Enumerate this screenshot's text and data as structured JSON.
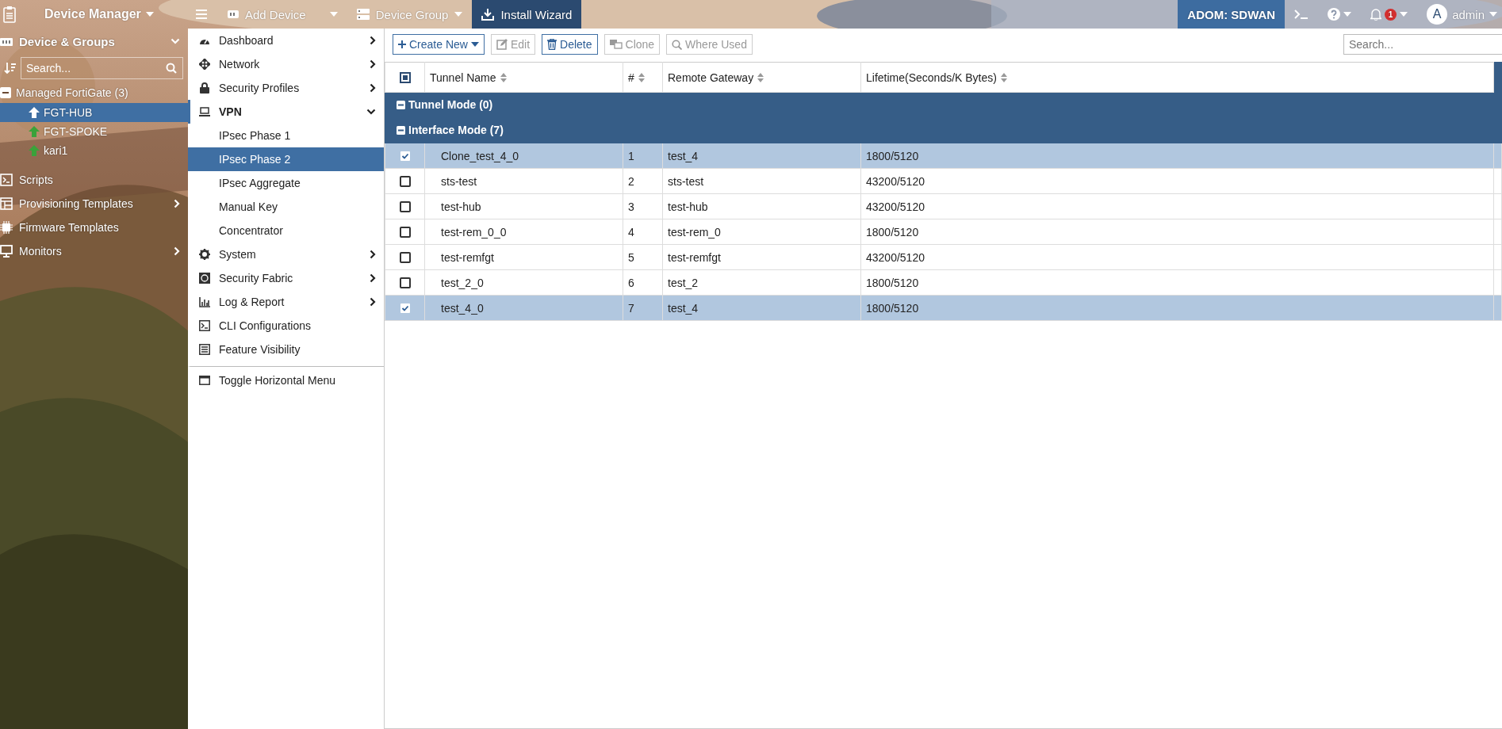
{
  "topbar": {
    "app": "Device Manager",
    "menu": [
      {
        "label": "Add Device",
        "kind": "split",
        "selected": false
      },
      {
        "label": "Device Group",
        "kind": "dropdown",
        "selected": false
      },
      {
        "label": "Install Wizard",
        "kind": "plain",
        "selected": true
      }
    ],
    "adom": "ADOM: SDWAN",
    "notifications": "1",
    "avatar": "A",
    "user": "admin"
  },
  "sidebar": {
    "title": "Device & Groups",
    "search_placeholder": "Search...",
    "tree": [
      {
        "label": "Managed FortiGate (3)",
        "expanded": true,
        "children": [
          {
            "label": "FGT-HUB",
            "selected": true
          },
          {
            "label": "FGT-SPOKE",
            "selected": false
          },
          {
            "label": "kari1",
            "selected": false
          }
        ]
      }
    ],
    "nav": [
      {
        "label": "Scripts",
        "has_submenu": false
      },
      {
        "label": "Provisioning Templates",
        "has_submenu": true
      },
      {
        "label": "Firmware Templates",
        "has_submenu": false
      },
      {
        "label": "Monitors",
        "has_submenu": true
      }
    ]
  },
  "menu": [
    {
      "label": "Dashboard",
      "has_submenu": true,
      "expanded": false
    },
    {
      "label": "Network",
      "has_submenu": true,
      "expanded": false
    },
    {
      "label": "Security Profiles",
      "has_submenu": true,
      "expanded": false
    },
    {
      "label": "VPN",
      "has_submenu": true,
      "expanded": true,
      "children": [
        {
          "label": "IPsec Phase 1",
          "selected": false
        },
        {
          "label": "IPsec Phase 2",
          "selected": true
        },
        {
          "label": "IPsec Aggregate",
          "selected": false
        },
        {
          "label": "Manual Key",
          "selected": false
        },
        {
          "label": "Concentrator",
          "selected": false
        }
      ]
    },
    {
      "label": "System",
      "has_submenu": true,
      "expanded": false
    },
    {
      "label": "Security Fabric",
      "has_submenu": true,
      "expanded": false
    },
    {
      "label": "Log & Report",
      "has_submenu": true,
      "expanded": false
    },
    {
      "label": "CLI Configurations",
      "has_submenu": false,
      "expanded": false
    },
    {
      "label": "Feature Visibility",
      "has_submenu": false,
      "expanded": false
    },
    {
      "label": "Toggle Horizontal Menu",
      "has_submenu": false,
      "expanded": false,
      "kind": "footer"
    }
  ],
  "toolbar": {
    "buttons": [
      {
        "label": "Create New",
        "disabled": false,
        "kind": "create"
      },
      {
        "label": "Edit",
        "disabled": true,
        "kind": "edit"
      },
      {
        "label": "Delete",
        "disabled": false,
        "kind": "delete"
      },
      {
        "label": "Clone",
        "disabled": true,
        "kind": "clone"
      },
      {
        "label": "Where Used",
        "disabled": true,
        "kind": "where"
      }
    ],
    "search_placeholder": "Search..."
  },
  "table": {
    "select_all_partial": true,
    "columns": [
      "Tunnel Name",
      "#",
      "Remote Gateway",
      "Lifetime(Seconds/K Bytes)"
    ],
    "groups": [
      {
        "label": "Tunnel Mode (0)",
        "expanded": true
      },
      {
        "label": "Interface Mode (7)",
        "expanded": true,
        "rows": [
          {
            "cells": [
              "Clone_test_4_0",
              "1",
              "test_4",
              "1800/5120"
            ],
            "selected": true
          },
          {
            "cells": [
              "sts-test",
              "2",
              "sts-test",
              "43200/5120"
            ],
            "selected": false
          },
          {
            "cells": [
              "test-hub",
              "3",
              "test-hub",
              "43200/5120"
            ],
            "selected": false
          },
          {
            "cells": [
              "test-rem_0_0",
              "4",
              "test-rem_0",
              "1800/5120"
            ],
            "selected": false
          },
          {
            "cells": [
              "test-remfgt",
              "5",
              "test-remfgt",
              "43200/5120"
            ],
            "selected": false
          },
          {
            "cells": [
              "test_2_0",
              "6",
              "test_2",
              "1800/5120"
            ],
            "selected": false
          },
          {
            "cells": [
              "test_4_0",
              "7",
              "test_4",
              "1800/5120"
            ],
            "selected": true
          }
        ]
      }
    ]
  }
}
